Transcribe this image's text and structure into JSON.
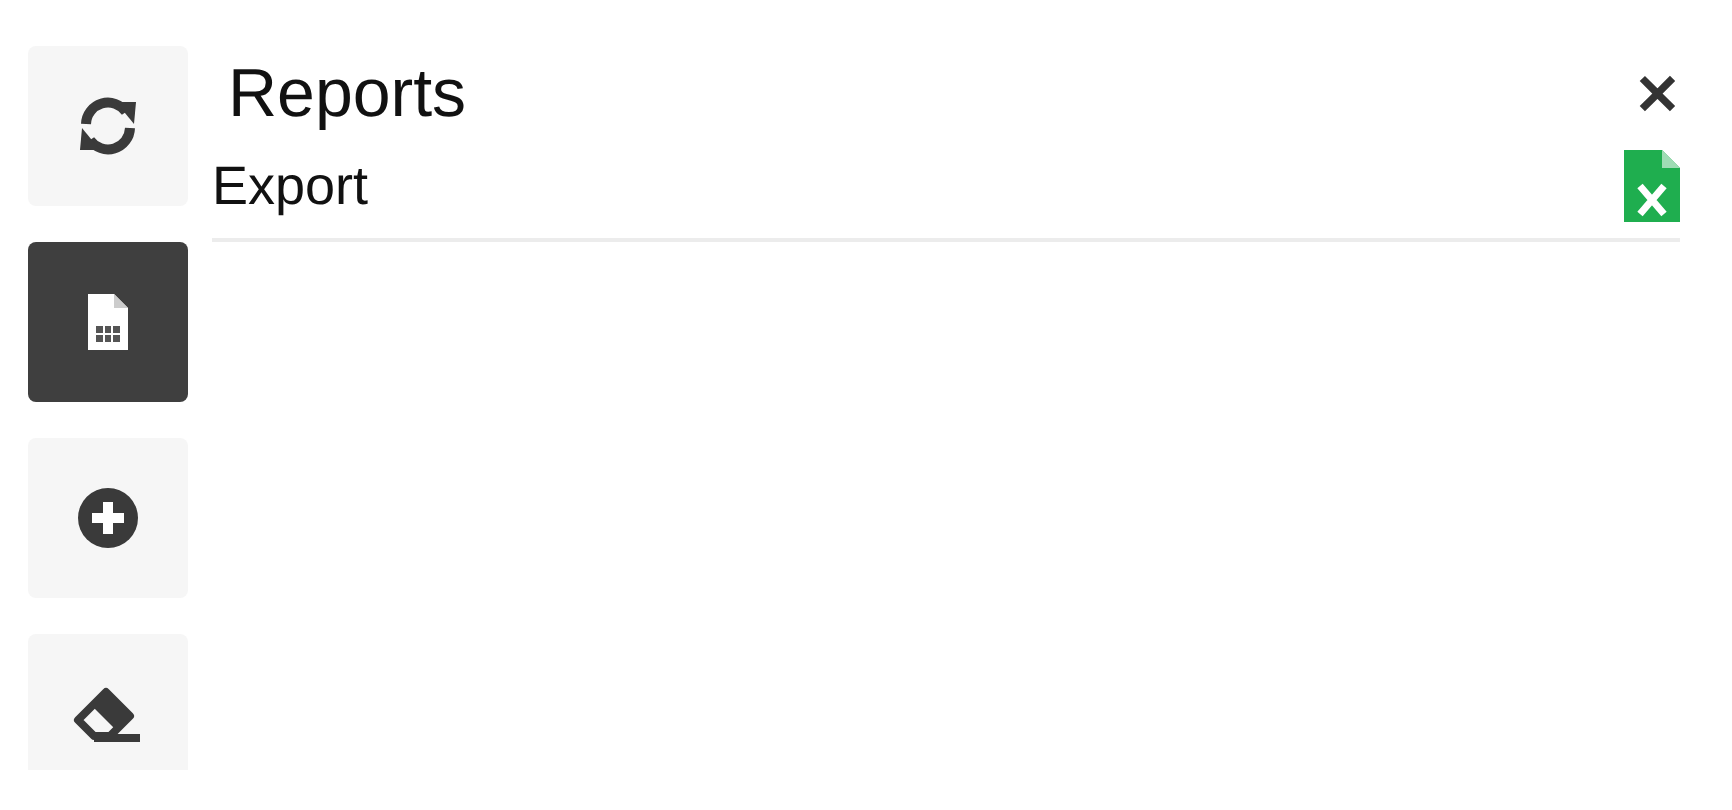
{
  "sidebar": {
    "buttons": [
      {
        "kind": "refresh",
        "selected": false
      },
      {
        "kind": "sheet",
        "selected": true
      },
      {
        "kind": "add",
        "selected": false
      },
      {
        "kind": "eraser",
        "selected": false
      }
    ]
  },
  "panel": {
    "title": "Reports",
    "close": "✕",
    "rows": [
      {
        "label": "Export",
        "kind": "excel"
      }
    ]
  }
}
